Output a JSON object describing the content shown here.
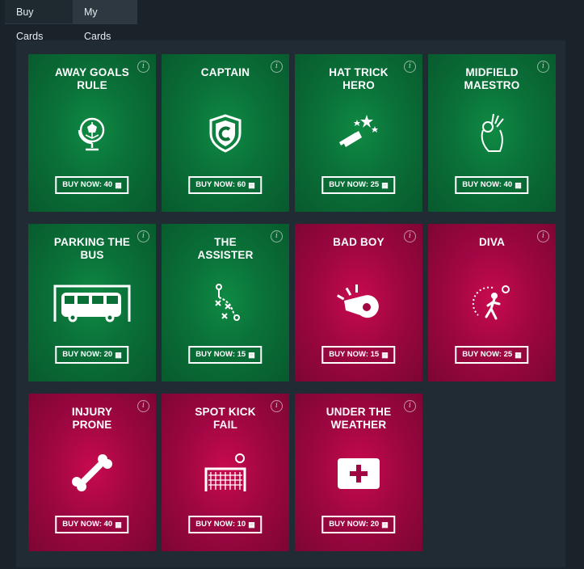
{
  "tabs": [
    {
      "label": "Buy Cards"
    },
    {
      "label": "My Cards"
    }
  ],
  "info_glyph": "i",
  "currency_icon": "cash-icon",
  "currency_glyph": "▦",
  "colors": {
    "green": "#0a7038",
    "red": "#a00742",
    "background": "#1b232a"
  },
  "cards": [
    {
      "title": "AWAY GOALS\nRULE",
      "buy_label": "BUY NOW: 40",
      "icon": "globe-ball-icon",
      "color": "green"
    },
    {
      "title": "CAPTAIN",
      "buy_label": "BUY NOW: 60",
      "icon": "captain-shield-icon",
      "color": "green"
    },
    {
      "title": "HAT TRICK\nHERO",
      "buy_label": "BUY NOW: 25",
      "icon": "magic-hat-icon",
      "color": "green"
    },
    {
      "title": "MIDFIELD\nMAESTRO",
      "buy_label": "BUY NOW: 40",
      "icon": "ok-hand-icon",
      "color": "green"
    },
    {
      "title": "PARKING THE\nBUS",
      "buy_label": "BUY NOW: 20",
      "icon": "bus-icon",
      "color": "green"
    },
    {
      "title": "THE\nASSISTER",
      "buy_label": "BUY NOW: 15",
      "icon": "tactics-icon",
      "color": "green"
    },
    {
      "title": "BAD BOY",
      "buy_label": "BUY NOW: 15",
      "icon": "whistle-icon",
      "color": "red"
    },
    {
      "title": "DIVA",
      "buy_label": "BUY NOW: 25",
      "icon": "diving-player-icon",
      "color": "red"
    },
    {
      "title": "INJURY\nPRONE",
      "buy_label": "BUY NOW: 40",
      "icon": "bone-icon",
      "color": "red"
    },
    {
      "title": "SPOT KICK\nFAIL",
      "buy_label": "BUY NOW: 10",
      "icon": "goal-net-icon",
      "color": "red"
    },
    {
      "title": "UNDER THE\nWEATHER",
      "buy_label": "BUY NOW: 20",
      "icon": "first-aid-icon",
      "color": "red"
    }
  ]
}
